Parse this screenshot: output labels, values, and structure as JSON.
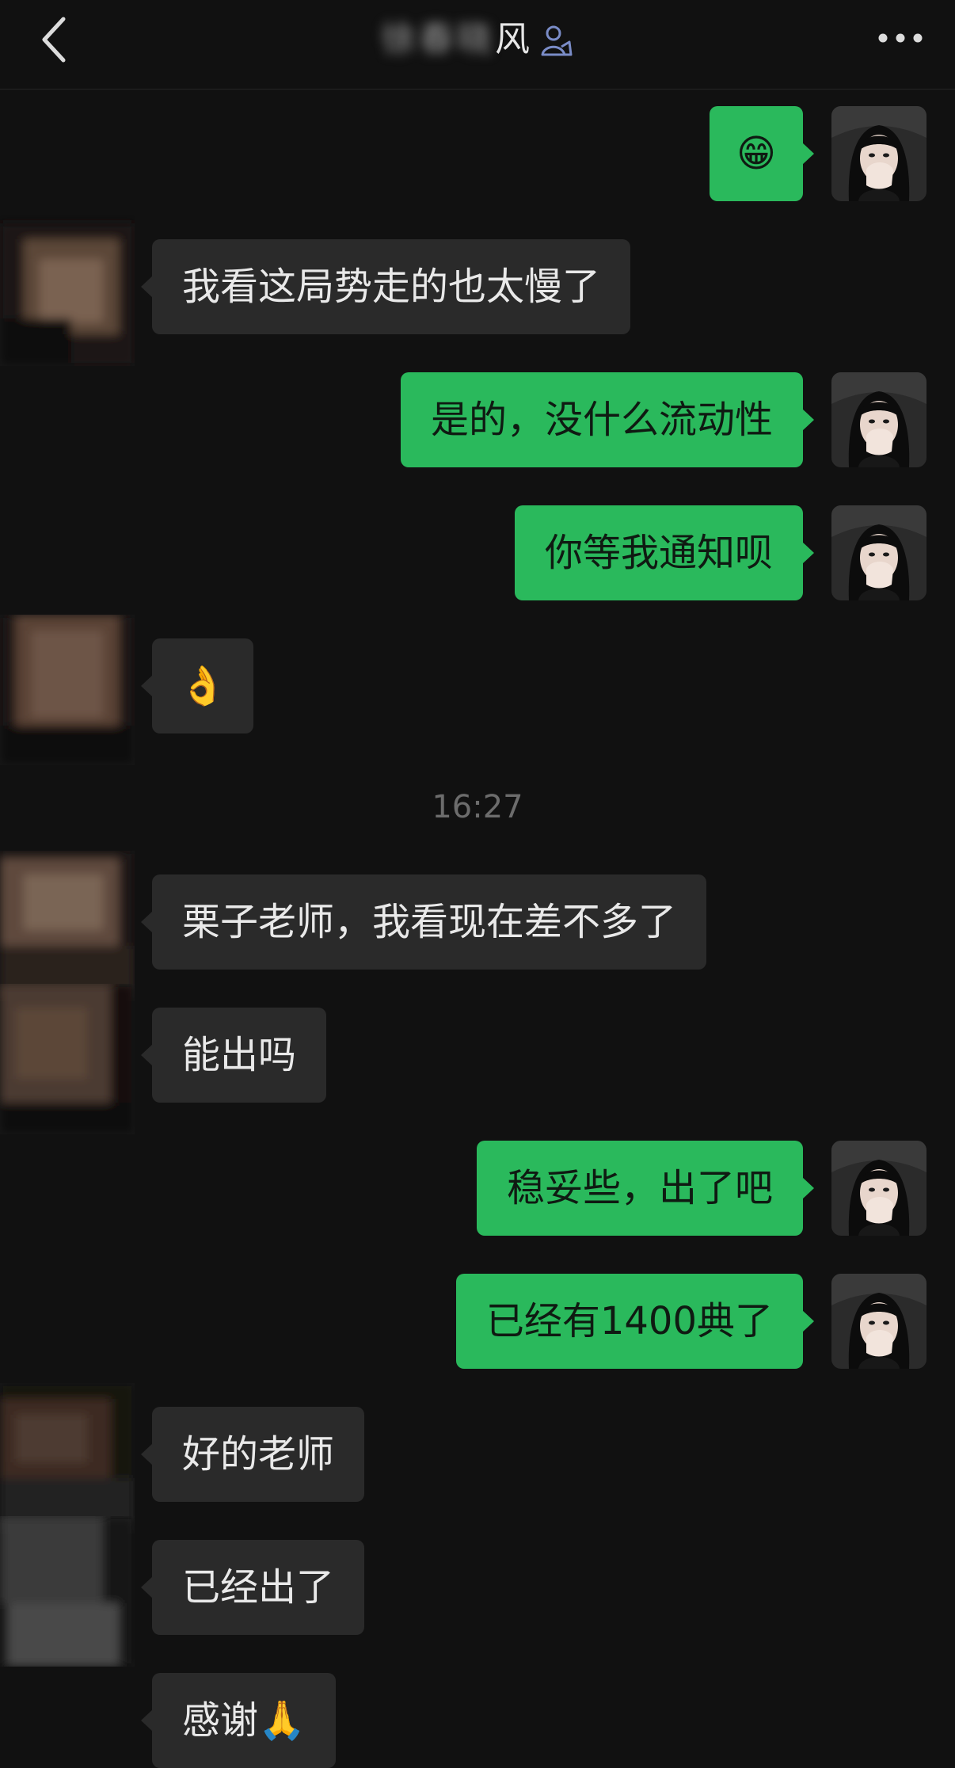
{
  "header": {
    "title_blurred": "徐春晓",
    "title_suffix": "风"
  },
  "chat": {
    "messages": [
      {
        "side": "out",
        "text": "😁",
        "emoji": "grinning-face-emoji"
      },
      {
        "side": "in",
        "text": "我看这局势走的也太慢了"
      },
      {
        "side": "out",
        "text": "是的，没什么流动性"
      },
      {
        "side": "out",
        "text": "你等我通知呗"
      },
      {
        "side": "in",
        "text": "👌",
        "emoji": "ok-hand-emoji"
      },
      {
        "side": "in",
        "text": "栗子老师，我看现在差不多了"
      },
      {
        "side": "in",
        "text": "能出吗"
      },
      {
        "side": "out",
        "text": "稳妥些，出了吧"
      },
      {
        "side": "out",
        "text": "已经有1400典了"
      },
      {
        "side": "in",
        "text": "好的老师"
      },
      {
        "side": "in",
        "text": "已经出了"
      },
      {
        "side": "in",
        "text": "感谢🙏"
      }
    ],
    "timestamp": "16:27"
  },
  "colors": {
    "background": "#111111",
    "outgoing_bubble": "#2ab95c",
    "incoming_bubble": "#2a2a2a",
    "timestamp_text": "#6c6c6c"
  },
  "icons": [
    "back-chevron-icon",
    "person-badge-icon",
    "more-dots-icon"
  ]
}
